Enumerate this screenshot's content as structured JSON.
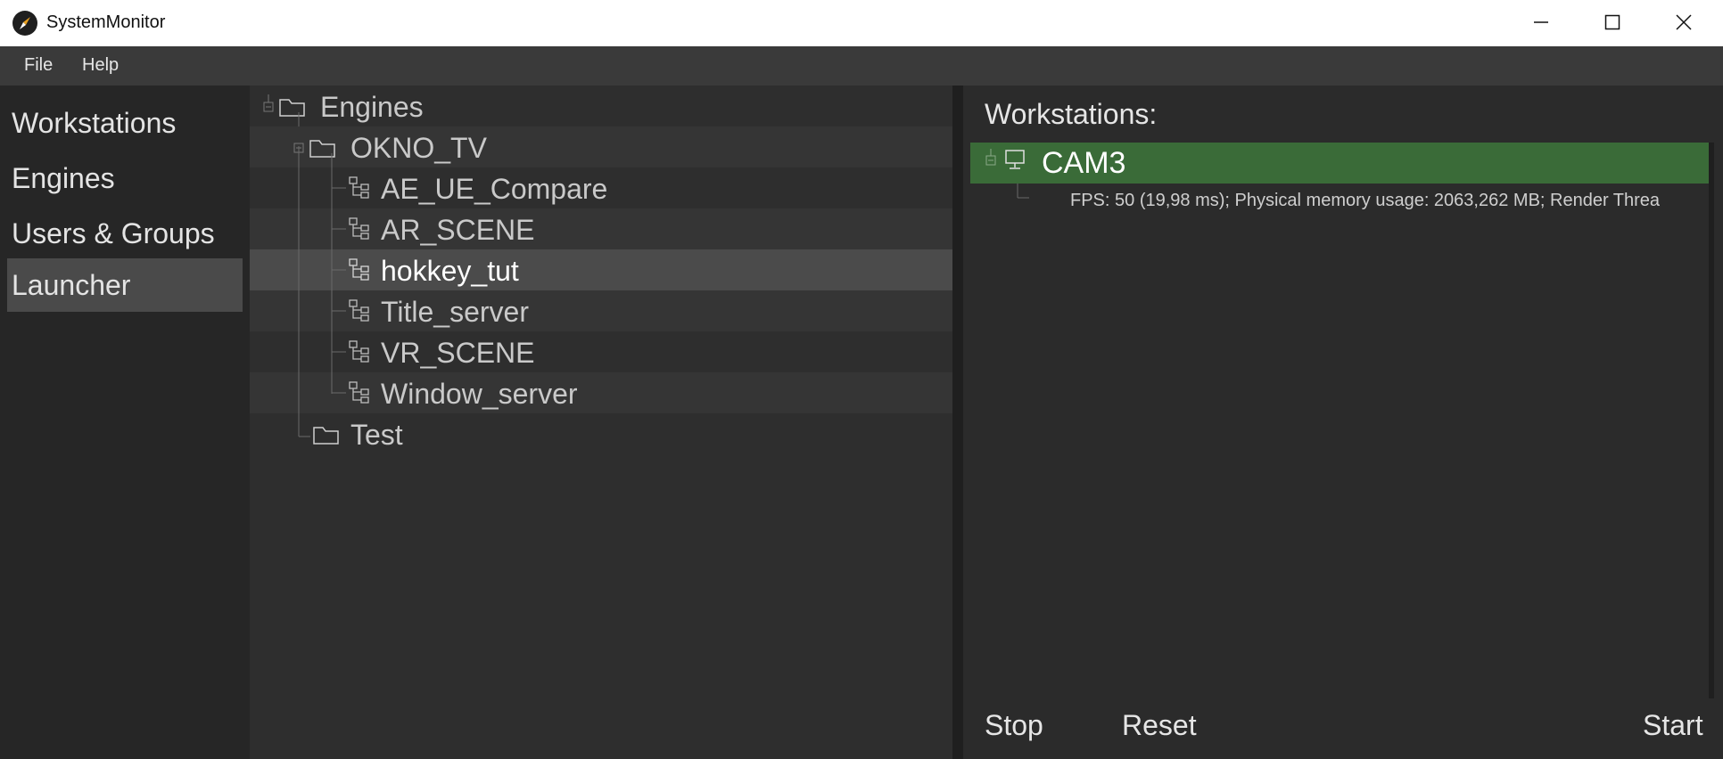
{
  "window": {
    "title": "SystemMonitor",
    "icon": "compass-icon"
  },
  "menu": {
    "file": "File",
    "help": "Help"
  },
  "nav": {
    "items": [
      {
        "label": "Workstations"
      },
      {
        "label": "Engines"
      },
      {
        "label": "Users & Groups"
      },
      {
        "label": "Launcher",
        "active": true
      }
    ]
  },
  "tree": {
    "root": "Engines",
    "group": "OKNO_TV",
    "scenes": [
      "AE_UE_Compare",
      "AR_SCENE",
      "hokkey_tut",
      "Title_server",
      "VR_SCENE",
      "Window_server"
    ],
    "selected": "hokkey_tut",
    "other_group": "Test"
  },
  "workstations": {
    "title": "Workstations:",
    "items": [
      {
        "name": "CAM3",
        "detail": "FPS: 50 (19,98 ms); Physical memory usage: 2063,262 MB; Render Threa"
      }
    ],
    "highlight_color": "#3a6b38"
  },
  "actions": {
    "stop": "Stop",
    "reset": "Reset",
    "start": "Start"
  }
}
